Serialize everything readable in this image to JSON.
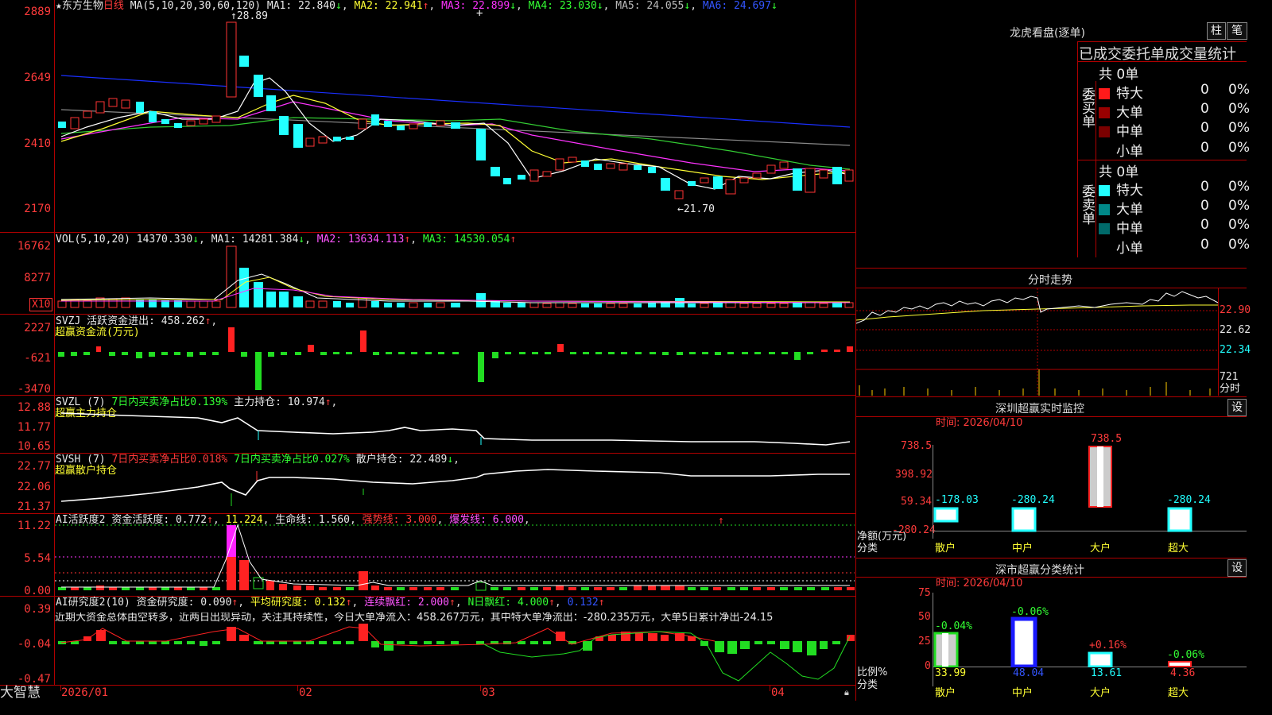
{
  "main": {
    "title_star": "★",
    "stock_name": "东方生物",
    "period": "日线",
    "ma_header": "MA(5,10,20,30,60,120)",
    "ma": [
      {
        "label": "MA1:",
        "value": "22.840",
        "arrow": "↓",
        "color": "#e8e8e8"
      },
      {
        "label": "MA2:",
        "value": "22.941",
        "arrow": "↑",
        "color": "#ffff33"
      },
      {
        "label": "MA3:",
        "value": "22.899",
        "arrow": "↓",
        "color": "#ff33ff"
      },
      {
        "label": "MA4:",
        "value": "23.030",
        "arrow": "↓",
        "color": "#33ff33"
      },
      {
        "label": "MA5:",
        "value": "24.055",
        "arrow": "↓",
        "color": "#aaaaaa"
      },
      {
        "label": "MA6:",
        "value": "24.697",
        "arrow": "↓",
        "color": "#3355ff"
      }
    ],
    "y_ticks": [
      "2889",
      "2649",
      "2410",
      "2170"
    ],
    "high_label": "28.89",
    "low_label": "←21.70",
    "cross_marker": "+"
  },
  "vol": {
    "header": "VOL(5,10,20)",
    "value": "14370.330",
    "arrow": "↓",
    "ma": [
      {
        "label": "MA1:",
        "value": "14281.384",
        "arrow": "↓"
      },
      {
        "label": "MA2:",
        "value": "13634.113",
        "arrow": "↑"
      },
      {
        "label": "MA3:",
        "value": "14530.054",
        "arrow": "↑"
      }
    ],
    "y_ticks": [
      "16762",
      "8277"
    ],
    "unit": "X10"
  },
  "svzj": {
    "header": "SVZJ",
    "text": "活跃资金进出:",
    "value": "458.262",
    "arrow": "↑",
    "sub": "超赢资金流(万元)",
    "y_ticks": [
      "2227",
      "-621",
      "-3470"
    ]
  },
  "svzl": {
    "header": "SVZL (7)",
    "t1": "7日内买卖净占比0.139%",
    "t2": "主力持仓:",
    "value": "10.974",
    "arrow": "↑",
    "sub": "超赢主力持仓",
    "y_ticks": [
      "12.88",
      "11.77",
      "10.65"
    ]
  },
  "svsh": {
    "header": "SVSH (7)",
    "t1": "7日内买卖净占比0.018%",
    "t2": "7日内买卖净占比0.027%",
    "t3": "散户持仓:",
    "value": "22.489",
    "arrow": "↓",
    "sub": "超赢散户持仓",
    "y_ticks": [
      "22.77",
      "22.06",
      "21.37"
    ]
  },
  "ai1": {
    "header": "AI活跃度2",
    "t1": "资金活跃度:",
    "v1": "0.772",
    "a1": "↑",
    "v2": "11.224",
    "t3": "生命线:",
    "v3": "1.560",
    "t4": "强势线:",
    "v4": "3.000",
    "t5": "爆发线:",
    "v5": "6.000",
    "y_ticks": [
      "11.22",
      "5.54",
      "0.00"
    ]
  },
  "ai2": {
    "header": "AI研究度2(10)",
    "t1": "资金研究度:",
    "v1": "0.090",
    "a1": "↑",
    "t2": "平均研究度:",
    "v2": "0.132",
    "a2": "↑",
    "t3": "连续飘红:",
    "v3": "2.000",
    "a3": "↑",
    "t4": "N日飘红:",
    "v4": "4.000",
    "a4": "↑",
    "v5": "0.132",
    "a5": "↑",
    "comment": "近期大资金总体由空转多，近两日出现异动，关注其持续性，今日大单净流入：458.267万元，其中特大单净流出：-280.235万元，大单5日累计净出-24.15",
    "y_ticks": [
      "0.39",
      "-0.04",
      "-0.47"
    ]
  },
  "xaxis": {
    "brand": "大智慧",
    "labels": [
      "2026/01",
      "02",
      "03",
      "04"
    ]
  },
  "right": {
    "dragon_title": "龙虎看盘(逐单)",
    "btn_zhu": "柱",
    "btn_bi": "笔",
    "stat_title": "已成交委托单成交量统计",
    "buy_group": "委买单",
    "sell_group": "委卖单",
    "buy_total": "共 0单",
    "sell_total": "共 0单",
    "buy_rows": [
      {
        "name": "特大",
        "count": "0",
        "pct": "0%",
        "color": "#ff1a1a"
      },
      {
        "name": "大单",
        "count": "0",
        "pct": "0%",
        "color": "#990000"
      },
      {
        "name": "中单",
        "count": "0",
        "pct": "0%",
        "color": "#7a0000"
      },
      {
        "name": "小单",
        "count": "0",
        "pct": "0%",
        "color": "#000000"
      }
    ],
    "sell_rows": [
      {
        "name": "特大",
        "count": "0",
        "pct": "0%",
        "color": "#22ffff"
      },
      {
        "name": "大单",
        "count": "0",
        "pct": "0%",
        "color": "#008888"
      },
      {
        "name": "中单",
        "count": "0",
        "pct": "0%",
        "color": "#006a6a"
      },
      {
        "name": "小单",
        "count": "0",
        "pct": "0%",
        "color": "#000000"
      }
    ],
    "intraday_title": "分时走势",
    "intraday_prices": [
      "22.90",
      "22.62",
      "22.34"
    ],
    "intraday_vol": "721",
    "intraday_unit": "分时",
    "monitor_title": "深圳超赢实时监控",
    "monitor_btn": "设",
    "monitor_time": "时间: 2026/04/10",
    "monitor_y": [
      "738.5",
      "398.92",
      "59.34",
      "-280.24"
    ],
    "monitor_ylabel": "净额(万元)",
    "monitor_xlabel": "分类",
    "monitor_cats": [
      "散户",
      "中户",
      "大户",
      "超大"
    ],
    "monitor_values": [
      "-178.03",
      "-280.24",
      "738.5",
      "-280.24"
    ],
    "class_title": "深市超赢分类统计",
    "class_btn": "设",
    "class_time": "时间: 2026/04/10",
    "class_y": [
      "75",
      "50",
      "25",
      "0"
    ],
    "class_ylabel": "比例%",
    "class_xlabel": "分类",
    "class_cats": [
      "散户",
      "中户",
      "大户",
      "超大"
    ],
    "class_values": [
      "33.99",
      "48.04",
      "13.61",
      "4.36"
    ],
    "class_changes": [
      "-0.04%",
      "-0.06%",
      "+0.16%",
      "-0.06%"
    ]
  }
}
